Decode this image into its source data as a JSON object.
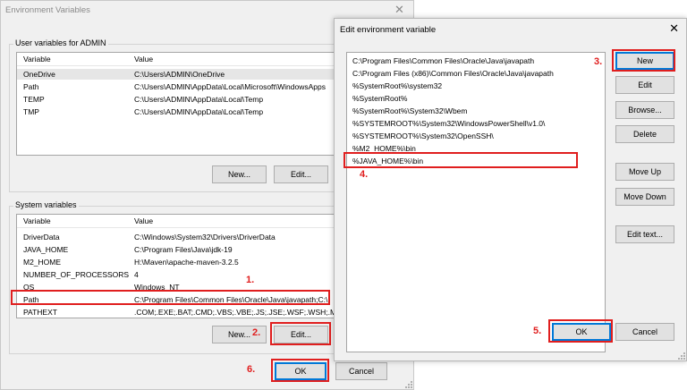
{
  "main_dialog": {
    "title": "Environment Variables",
    "close_glyph": "✕",
    "user_group_label": "User variables for ADMIN",
    "user_columns": [
      "Variable",
      "Value"
    ],
    "user_rows": [
      {
        "variable": "OneDrive",
        "value": "C:\\Users\\ADMIN\\OneDrive"
      },
      {
        "variable": "Path",
        "value": "C:\\Users\\ADMIN\\AppData\\Local\\Microsoft\\WindowsApps"
      },
      {
        "variable": "TEMP",
        "value": "C:\\Users\\ADMIN\\AppData\\Local\\Temp"
      },
      {
        "variable": "TMP",
        "value": "C:\\Users\\ADMIN\\AppData\\Local\\Temp"
      }
    ],
    "user_new_label": "New...",
    "user_edit_label": "Edit...",
    "system_group_label": "System variables",
    "system_columns": [
      "Variable",
      "Value"
    ],
    "system_rows": [
      {
        "variable": "DriverData",
        "value": "C:\\Windows\\System32\\Drivers\\DriverData"
      },
      {
        "variable": "JAVA_HOME",
        "value": "C:\\Program Files\\Java\\jdk-19"
      },
      {
        "variable": "M2_HOME",
        "value": "H:\\Maven\\apache-maven-3.2.5"
      },
      {
        "variable": "NUMBER_OF_PROCESSORS",
        "value": "4"
      },
      {
        "variable": "OS",
        "value": "Windows_NT"
      },
      {
        "variable": "Path",
        "value": "C:\\Program Files\\Common Files\\Oracle\\Java\\javapath;C:\\"
      },
      {
        "variable": "PATHEXT",
        "value": ".COM;.EXE;.BAT;.CMD;.VBS;.VBE;.JS;.JSE;.WSF;.WSH;.MSC"
      }
    ],
    "system_new_label": "New...",
    "system_edit_label": "Edit...",
    "ok_label": "OK",
    "cancel_label": "Cancel"
  },
  "edit_dialog": {
    "title": "Edit environment variable",
    "close_glyph": "✕",
    "paths": [
      "C:\\Program Files\\Common Files\\Oracle\\Java\\javapath",
      "C:\\Program Files (x86)\\Common Files\\Oracle\\Java\\javapath",
      "%SystemRoot%\\system32",
      "%SystemRoot%",
      "%SystemRoot%\\System32\\Wbem",
      "%SYSTEMROOT%\\System32\\WindowsPowerShell\\v1.0\\",
      "%SYSTEMROOT%\\System32\\OpenSSH\\",
      "%M2_HOME%\\bin",
      "%JAVA_HOME%\\bin"
    ],
    "buttons": {
      "new": "New",
      "edit": "Edit",
      "browse": "Browse...",
      "delete": "Delete",
      "move_up": "Move Up",
      "move_down": "Move Down",
      "edit_text": "Edit text..."
    },
    "ok_label": "OK",
    "cancel_label": "Cancel"
  },
  "annotations": {
    "step1": "1.",
    "step2": "2.",
    "step3": "3.",
    "step4": "4.",
    "step5": "5.",
    "step6": "6."
  },
  "colors": {
    "highlight": "#e01e1e",
    "focus_border": "#0078d7",
    "dialog_bg": "#f0f0f0"
  }
}
